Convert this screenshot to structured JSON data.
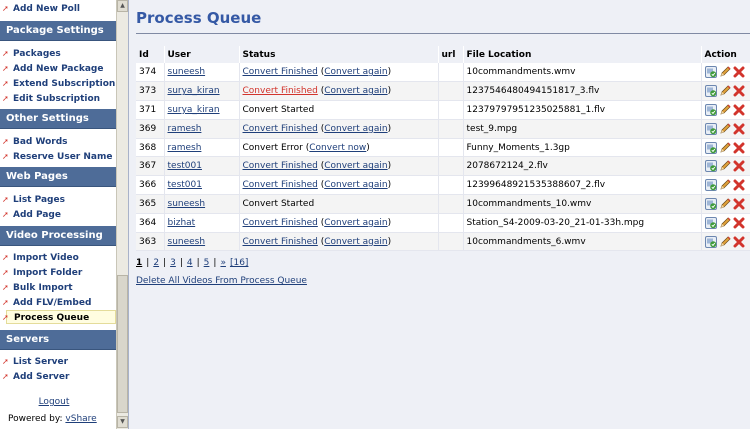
{
  "sidebar": {
    "top_item": "Add New Poll",
    "sections": [
      {
        "title": "Package Settings",
        "items": [
          "Packages",
          "Add New Package",
          "Extend Subscription",
          "Edit Subscription"
        ]
      },
      {
        "title": "Other Settings",
        "items": [
          "Bad Words",
          "Reserve User Name"
        ]
      },
      {
        "title": "Web Pages",
        "items": [
          "List Pages",
          "Add Page"
        ]
      },
      {
        "title": "Video Processing",
        "items": [
          "Import Video",
          "Import Folder",
          "Bulk Import",
          "Add FLV/Embed",
          "Process Queue"
        ]
      },
      {
        "title": "Servers",
        "items": [
          "List Server",
          "Add Server"
        ]
      }
    ],
    "logout": "Logout",
    "powered_by": "Powered by:",
    "powered_link": "vShare"
  },
  "main": {
    "title": "Process Queue",
    "columns": [
      "Id",
      "User",
      "Status",
      "url",
      "File Location",
      "Action"
    ],
    "rows": [
      {
        "id": "374",
        "user": "suneesh",
        "status_a": "Convert Finished",
        "status_b": "Convert again",
        "file": "10commandments.wmv"
      },
      {
        "id": "373",
        "user": "surya_kiran",
        "status_a": "Convert Finished",
        "status_b": "Convert again",
        "file": "1237546480494151817_3.flv"
      },
      {
        "id": "371",
        "user": "surya_kiran",
        "status_a": "Convert Started",
        "status_b": "",
        "file": "12379797951235025881_1.flv"
      },
      {
        "id": "369",
        "user": "ramesh",
        "status_a": "Convert Finished",
        "status_b": "Convert again",
        "file": "test_9.mpg"
      },
      {
        "id": "368",
        "user": "ramesh",
        "status_a": "Convert Error",
        "status_b": "Convert now",
        "file": "Funny_Moments_1.3gp"
      },
      {
        "id": "367",
        "user": "test001",
        "status_a": "Convert Finished",
        "status_b": "Convert again",
        "file": "2078672124_2.flv"
      },
      {
        "id": "366",
        "user": "test001",
        "status_a": "Convert Finished",
        "status_b": "Convert again",
        "file": "12399648921535388607_2.flv"
      },
      {
        "id": "365",
        "user": "suneesh",
        "status_a": "Convert Started",
        "status_b": "",
        "file": "10commandments_10.wmv"
      },
      {
        "id": "364",
        "user": "bizhat",
        "status_a": "Convert Finished",
        "status_b": "Convert again",
        "file": "Station_S4-2009-03-20_21-01-33h.mpg"
      },
      {
        "id": "363",
        "user": "suneesh",
        "status_a": "Convert Finished",
        "status_b": "Convert again",
        "file": "10commandments_6.wmv"
      }
    ],
    "pagination": [
      "1",
      "2",
      "3",
      "4",
      "5",
      "»",
      "[16]"
    ],
    "delete_all": "Delete All Videos From Process Queue"
  },
  "colors": {
    "accent": "#3559a5",
    "sidebar_header": "#4e6c98",
    "link": "#1f3f7a",
    "error": "#d2342c"
  }
}
